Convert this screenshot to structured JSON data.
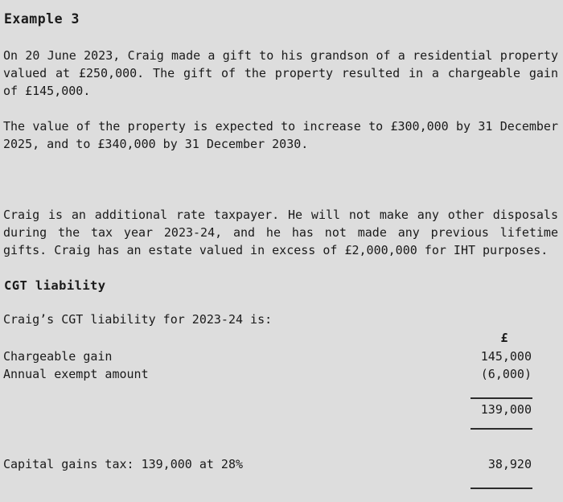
{
  "document": {
    "title": "Example 3",
    "paragraphs": [
      "On 20 June 2023, Craig made a gift to his grandson of a residential property valued at £250,000. The gift of the property resulted in a chargeable gain of £145,000.",
      "The value of the property is expected to increase to £300,000 by 31 December 2025, and to £340,000 by 31 December 2030.",
      "Craig is an additional rate taxpayer. He will not make any other disposals during the tax year 2023-24, and he has not made any previous lifetime gifts. Craig has an estate valued in excess of £2,000,000 for IHT purposes."
    ],
    "section_heading": "CGT liability",
    "lead_line": "Craig’s CGT liability for 2023-24 is:",
    "computation": {
      "currency_header": "£",
      "rows": [
        {
          "label": "Chargeable gain",
          "amount": "145,000"
        },
        {
          "label": "Annual exempt amount",
          "amount": "(6,000)"
        },
        {
          "label": "",
          "amount": "139,000"
        },
        {
          "label": "Capital gains tax: 139,000 at 28%",
          "amount": "38,920"
        }
      ]
    }
  }
}
